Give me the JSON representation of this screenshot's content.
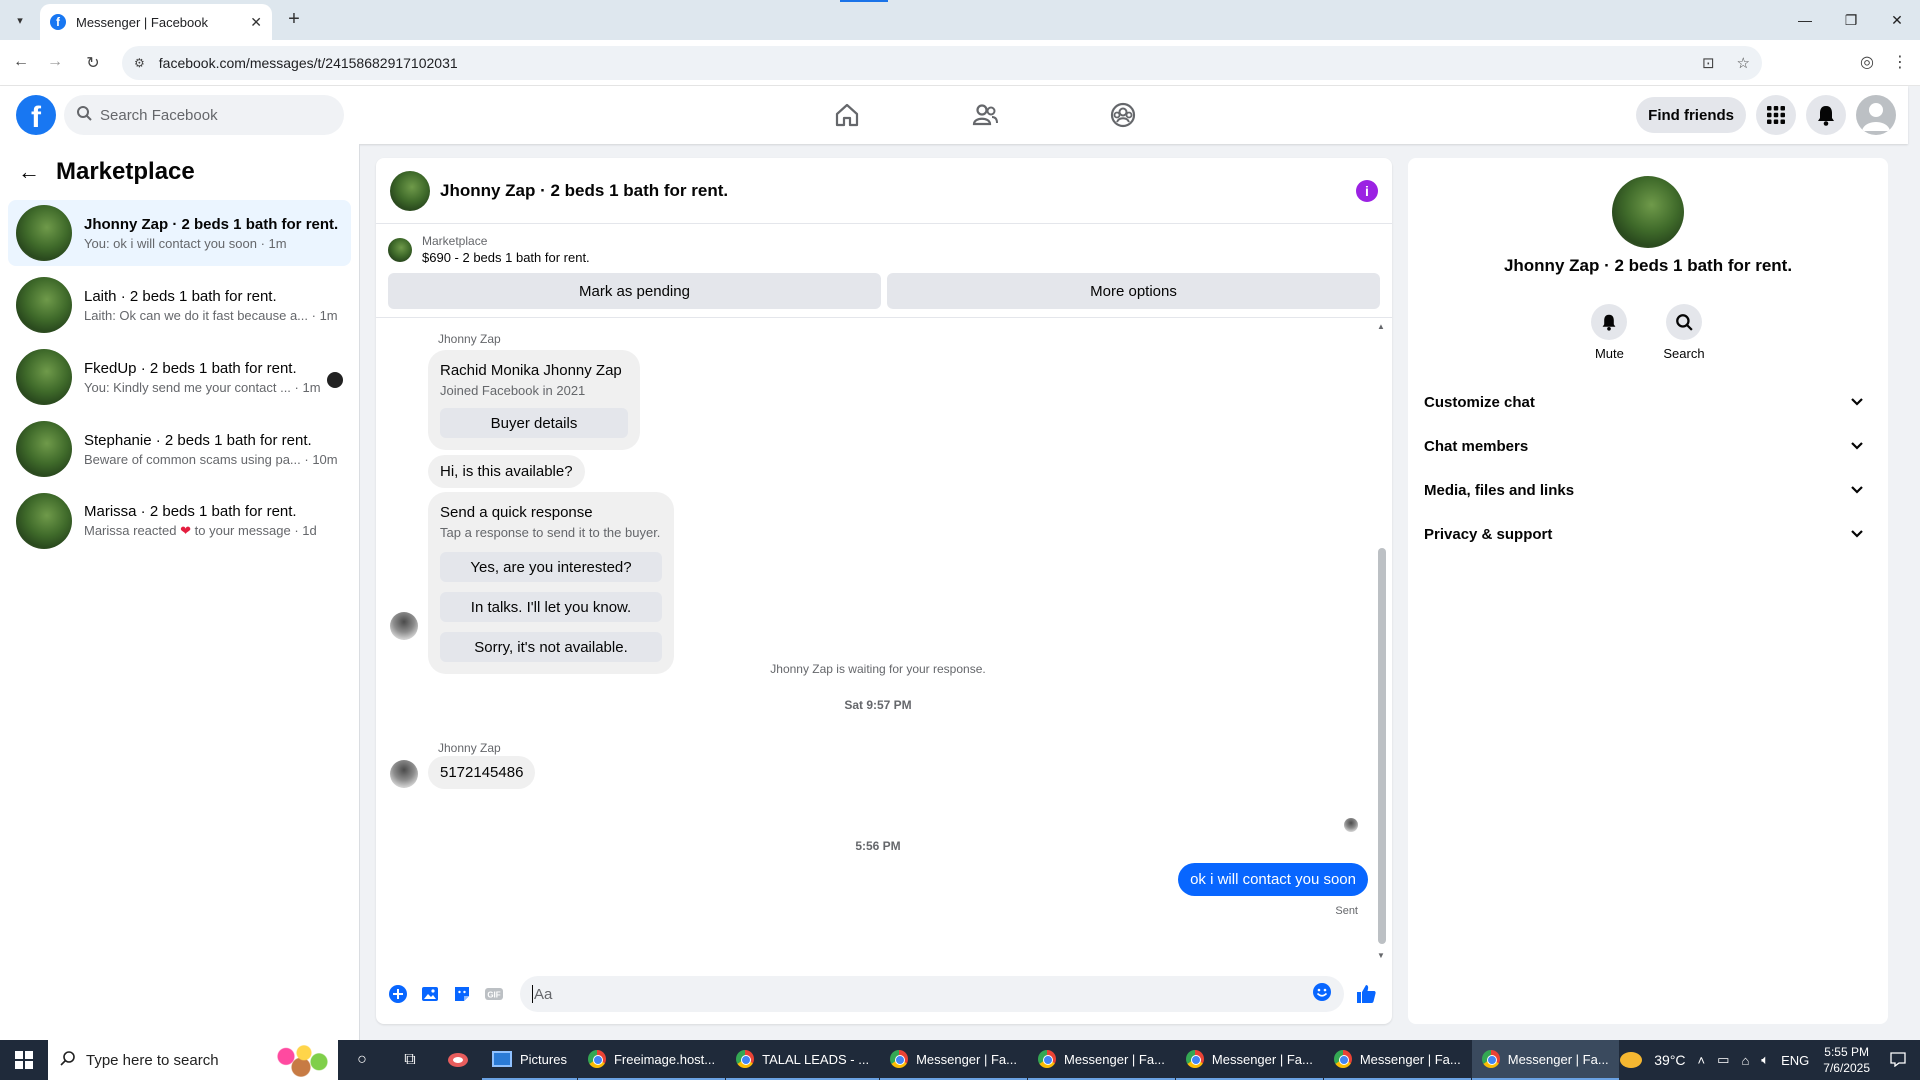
{
  "browser": {
    "tab_title": "Messenger | Facebook",
    "url": "facebook.com/messages/t/24158682917102031"
  },
  "fb_nav": {
    "search_placeholder": "Search Facebook",
    "find_friends": "Find friends"
  },
  "sidebar": {
    "title": "Marketplace",
    "conversations": [
      {
        "name": "Jhonny Zap · 2 beds 1 bath for rent.",
        "preview": "You: ok i will contact you soon · 1m"
      },
      {
        "name": "Laith · 2 beds 1 bath for rent.",
        "preview": "Laith: Ok can we do it fast because a... · 1m"
      },
      {
        "name": "FkedUp · 2 beds 1 bath for rent.",
        "preview": "You: Kindly send me your contact ... · 1m"
      },
      {
        "name": "Stephanie · 2 beds 1 bath for rent.",
        "preview": "Beware of common scams using pa... · 10m"
      },
      {
        "name": "Marissa · 2 beds 1 bath for rent.",
        "preview_a": "Marissa reacted",
        "preview_b": "to your message · 1d"
      }
    ]
  },
  "chat": {
    "header_title": "Jhonny Zap · 2 beds 1 bath for rent.",
    "marketplace_label": "Marketplace",
    "listing": "$690 - 2 beds 1 bath for rent.",
    "mark_pending": "Mark as pending",
    "more_options": "More options",
    "sender_name": "Jhonny Zap",
    "card_name": "Rachid Monika Jhonny Zap",
    "card_joined": "Joined Facebook in 2021",
    "buyer_details": "Buyer details",
    "msg_available": "Hi, is this available?",
    "quick_title": "Send a quick response",
    "quick_sub": "Tap a response to send it to the buyer.",
    "quick_1": "Yes, are you interested?",
    "quick_2": "In talks. I'll let you know.",
    "quick_3": "Sorry, it's not available.",
    "waiting_note": "Jhonny Zap is waiting for your response.",
    "time_1": "Sat 9:57 PM",
    "phone_msg": "5172145486",
    "time_2": "5:56 PM",
    "my_msg": "ok i will contact you soon",
    "sent": "Sent",
    "composer_placeholder": "Aa"
  },
  "info_panel": {
    "name": "Jhonny Zap · 2 beds 1 bath for rent.",
    "mute": "Mute",
    "search": "Search",
    "sections": [
      "Customize chat",
      "Chat members",
      "Media, files and links",
      "Privacy & support"
    ]
  },
  "taskbar": {
    "search_placeholder": "Type here to search",
    "apps": [
      "Pictures",
      "Freeimage.host...",
      "TALAL LEADS - ...",
      "Messenger | Fa...",
      "Messenger | Fa...",
      "Messenger | Fa...",
      "Messenger | Fa...",
      "Messenger | Fa..."
    ],
    "weather": "39°C",
    "lang": "ENG",
    "time": "5:55 PM",
    "date": "7/6/2025"
  },
  "colors": {
    "fb_blue": "#1877f2",
    "messenger_blue": "#0866ff",
    "info_purple": "#9b22e3"
  }
}
